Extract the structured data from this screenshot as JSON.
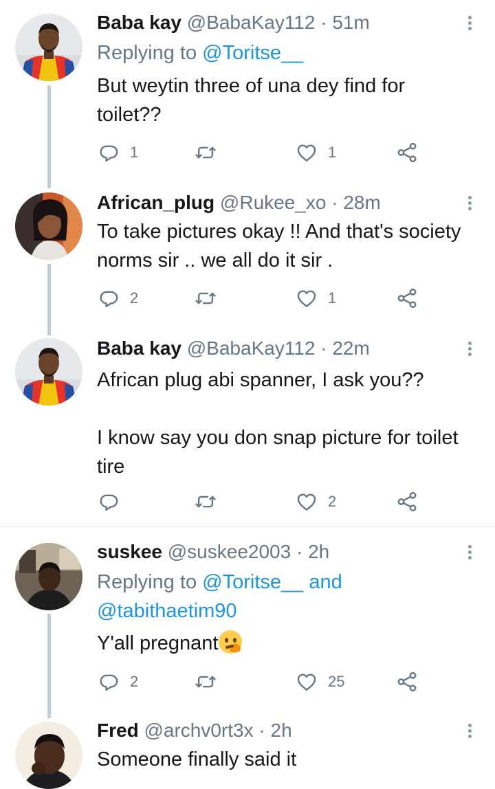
{
  "tweets": [
    {
      "name": "Baba kay",
      "handle": "@BabaKay112",
      "dot": "·",
      "time": "51m",
      "replying_prefix": "Replying to ",
      "replying_mention": "@Toritse__",
      "body": "But weytin three of una dey find for toilet??",
      "reply_count": "1",
      "retweet_count": "",
      "like_count": "1"
    },
    {
      "name": "African_plug",
      "handle": "@Rukee_xo",
      "dot": "·",
      "time": "28m",
      "body": "To take pictures okay !! And that's society norms sir .. we all do it sir .",
      "reply_count": "2",
      "retweet_count": "",
      "like_count": "1"
    },
    {
      "name": "Baba kay",
      "handle": "@BabaKay112",
      "dot": "·",
      "time": "22m",
      "body_line1": "African plug abi spanner, I ask you??",
      "body_line2": "I know say you don snap picture for toilet tire",
      "reply_count": "",
      "retweet_count": "",
      "like_count": "2"
    },
    {
      "name": "suskee",
      "handle": "@suskee2003",
      "dot": "·",
      "time": "2h",
      "replying_prefix": "Replying to ",
      "replying_mention1": "@Toritse__",
      "replying_and": " and",
      "replying_mention2": "@tabithaetim90",
      "body": "Y'all pregnant",
      "emoji": "thinking-face",
      "reply_count": "2",
      "retweet_count": "",
      "like_count": "25"
    },
    {
      "name": "Fred",
      "handle": "@archv0rt3x",
      "dot": "·",
      "time": "2h",
      "body": "Someone finally said it"
    }
  ],
  "icons": {
    "reply": "reply-icon",
    "retweet": "retweet-icon",
    "like": "like-icon",
    "share": "share-icon",
    "more": "more-options-icon"
  },
  "colors": {
    "link": "#1b95e0",
    "secondary_text": "#657786",
    "thread_line": "#c4cfd6",
    "divider": "#e1e8ed"
  }
}
